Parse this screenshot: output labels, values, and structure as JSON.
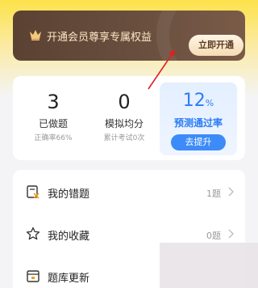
{
  "vip": {
    "text": "开通会员尊享专属权益",
    "button": "立即开通"
  },
  "stats": {
    "done": {
      "value": "3",
      "label": "已做题",
      "sub": "正确率66%"
    },
    "mock": {
      "value": "0",
      "label": "模拟均分",
      "sub": "累计考试0次"
    },
    "pass": {
      "value": "12",
      "unit": "%",
      "label": "预测通过率",
      "button": "去提升"
    }
  },
  "menu": [
    {
      "label": "我的错题",
      "count": "1题",
      "icon": "wrong-answers-icon"
    },
    {
      "label": "我的收藏",
      "count": "0题",
      "icon": "star-icon"
    },
    {
      "label": "题库更新",
      "count": "",
      "icon": "calendar-icon"
    }
  ],
  "colors": {
    "accent_blue": "#2c7cf6",
    "vip_brown": "#5a4233",
    "arrow_red": "#e02020"
  }
}
